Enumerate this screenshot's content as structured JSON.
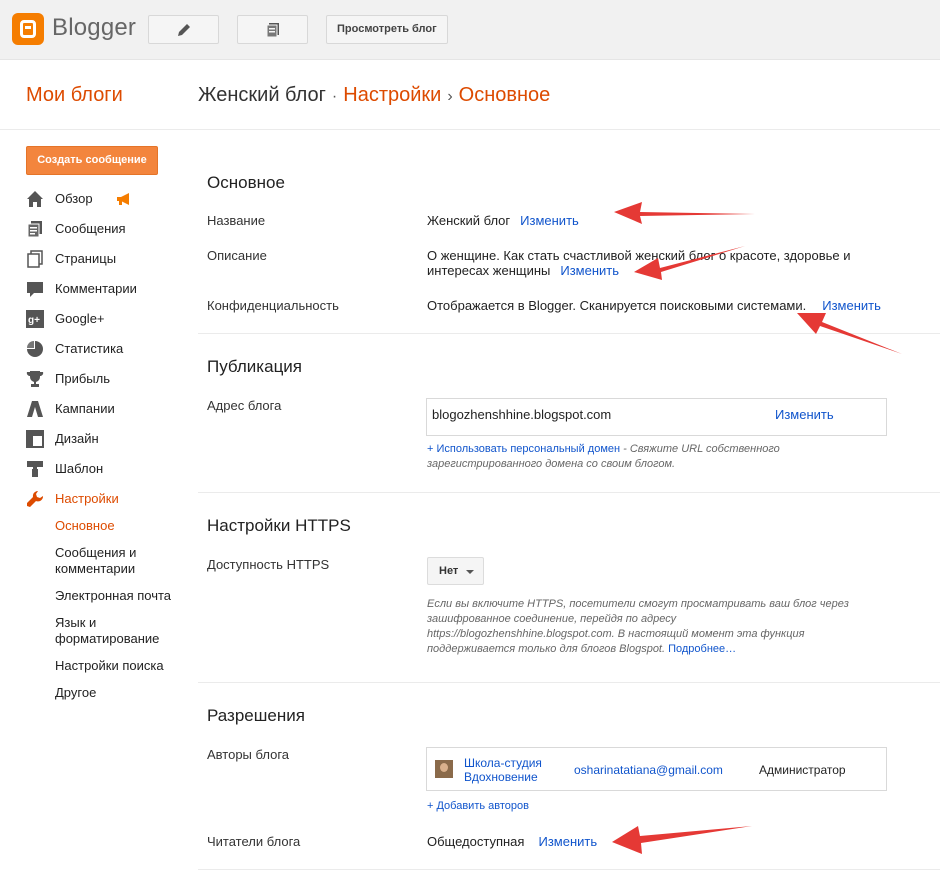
{
  "app": {
    "brand": "Blogger",
    "view_blog": "Просмотреть блог"
  },
  "header": {
    "my_blogs": "Мои блоги",
    "crumb_blog": "Женский блог",
    "crumb_sep1": "·",
    "crumb_settings": "Настройки",
    "crumb_sep2": "›",
    "crumb_current": "Основное"
  },
  "sidebar": {
    "create_label": "Создать сообщение",
    "items": [
      {
        "label": "Обзор",
        "icon": "home-icon"
      },
      {
        "label": "Сообщения",
        "icon": "posts-icon"
      },
      {
        "label": "Страницы",
        "icon": "pages-icon"
      },
      {
        "label": "Комментарии",
        "icon": "comment-icon"
      },
      {
        "label": "Google+",
        "icon": "google-plus-icon"
      },
      {
        "label": "Статистика",
        "icon": "stats-icon"
      },
      {
        "label": "Прибыль",
        "icon": "trophy-icon"
      },
      {
        "label": "Кампании",
        "icon": "campaign-icon"
      },
      {
        "label": "Дизайн",
        "icon": "layout-icon"
      },
      {
        "label": "Шаблон",
        "icon": "template-icon"
      },
      {
        "label": "Настройки",
        "icon": "wrench-icon"
      }
    ],
    "sub_items": [
      "Основное",
      "Сообщения и комментарии",
      "Электронная почта",
      "Язык и форматирование",
      "Настройки поиска",
      "Другое"
    ]
  },
  "basic": {
    "title": "Основное",
    "name_label": "Название",
    "name_value": "Женский блог",
    "change": "Изменить",
    "desc_label": "Описание",
    "desc_value": "О женщине. Как стать счастливой женский блог о красоте, здоровье и интересах женщины",
    "privacy_label": "Конфиденциальность",
    "privacy_value": "Отображается в Blogger. Сканируется поисковыми системами."
  },
  "publishing": {
    "title": "Публикация",
    "address_label": "Адрес блога",
    "address_value": "blogozhenshhine.blogspot.com",
    "change": "Изменить",
    "custom_domain_link": "+ Использовать персональный домен",
    "custom_domain_hint": " - Свяжите URL собственного зарегистрированного домена со своим блогом."
  },
  "https": {
    "title": "Настройки HTTPS",
    "availability_label": "Доступность HTTPS",
    "selected": "Нет",
    "hint": "Если вы включите HTTPS, посетители смогут просматривать ваш блог через зашифрованное соединение, перейдя по адресу https://blogozhenshhine.blogspot.com. В настоящий момент эта функция поддерживается только для блогов Blogspot.",
    "more_link": "Подробнее…"
  },
  "permissions": {
    "title": "Разрешения",
    "authors_label": "Авторы блога",
    "author_name": "Школа-студия Вдохновение",
    "author_email": "osharinatatiana@gmail.com",
    "author_role": "Администратор",
    "add_authors": "+ Добавить авторов",
    "readers_label": "Читатели блога",
    "readers_value": "Общедоступная",
    "change": "Изменить"
  },
  "colors": {
    "accent": "#dd4b00",
    "button": "#f3853d",
    "link": "#1155cc",
    "arrow": "#e53935"
  }
}
